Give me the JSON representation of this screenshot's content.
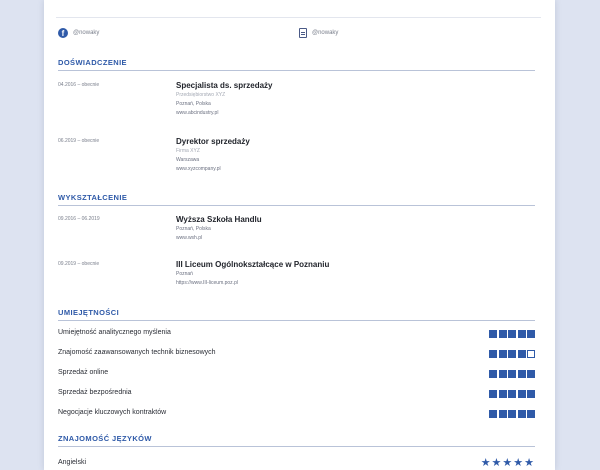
{
  "social": {
    "facebook": {
      "handle": "@nowaky"
    },
    "skype": {
      "handle": "@nowaky"
    }
  },
  "sections": {
    "experience": "DOŚWIADCZENIE",
    "education": "WYKSZTAŁCENIE",
    "skills": "UMIEJĘTNOŚCI",
    "languages": "ZNAJOMOŚĆ JĘZYKÓW"
  },
  "experience": [
    {
      "date": "04.2016 – obecnie",
      "title": "Specjalista ds. sprzedaży",
      "company": "Przedsiębiorstwo XYZ",
      "location": "Poznań, Polska",
      "url": "www.abcindustry.pl"
    },
    {
      "date": "06.2019 – obecnie",
      "title": "Dyrektor sprzedaży",
      "company": "Firma XYZ",
      "location": "Warszawa",
      "url": "www.xyzcompany.pl"
    }
  ],
  "education": [
    {
      "date": "09.2016 – 06.2019",
      "title": "Wyższa Szkoła Handlu",
      "location": "Poznań, Polska",
      "url": "www.wsh.pl"
    },
    {
      "date": "09.2019 – obecnie",
      "title": "III Liceum Ogólnokształcące w Poznaniu",
      "location": "Poznań",
      "url": "https://www.III-liceum.poz.pl"
    }
  ],
  "skills": [
    {
      "name": "Umiejętność analitycznego myślenia",
      "level": 5,
      "max": 5
    },
    {
      "name": "Znajomość zaawansowanych technik biznesowych",
      "level": 4,
      "max": 5
    },
    {
      "name": "Sprzedaż online",
      "level": 5,
      "max": 5
    },
    {
      "name": "Sprzedaż bezpośrednia",
      "level": 5,
      "max": 5
    },
    {
      "name": "Negocjacje kluczowych kontraktów",
      "level": 5,
      "max": 5
    }
  ],
  "languages": [
    {
      "name": "Angielski",
      "stars": "★★★★★",
      "level": 5
    }
  ],
  "colors": {
    "accent": "#2f5aa8",
    "rule": "#b9c3d8",
    "background": "#dde3f1"
  },
  "icons": {
    "facebook": "facebook-icon",
    "skype": "document-icon"
  }
}
